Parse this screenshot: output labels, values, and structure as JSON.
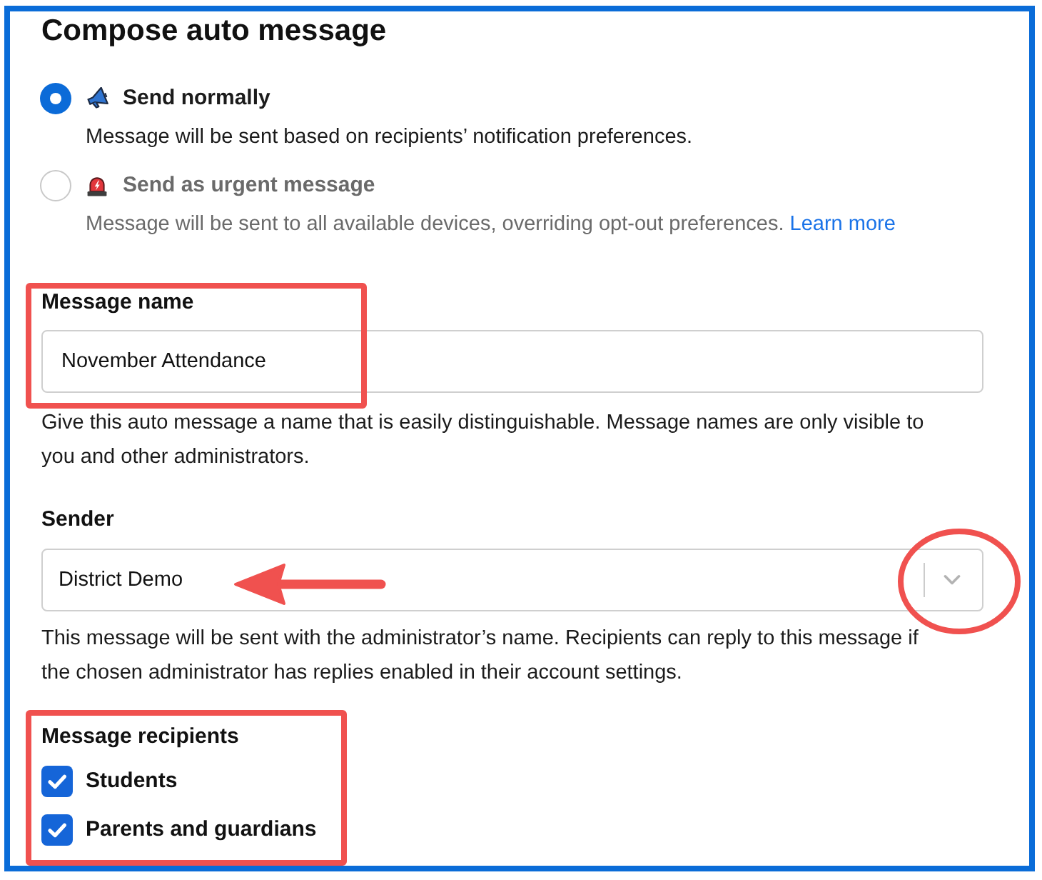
{
  "title": "Compose auto message",
  "delivery_options": [
    {
      "kind": "normal",
      "label": "Send normally",
      "description": "Message will be sent based on recipients’ notification preferences.",
      "selected": true
    },
    {
      "kind": "urgent",
      "label": "Send as urgent message",
      "description": "Message will be sent to all available devices, overriding opt-out preferences.",
      "link": "Learn more",
      "selected": false
    }
  ],
  "message_name": {
    "label": "Message name",
    "value": "November Attendance",
    "help": "Give this auto message a name that is easily distinguishable. Message names are only visible to you and other administrators."
  },
  "sender": {
    "label": "Sender",
    "value": "District Demo",
    "help": "This message will be sent with the administrator’s name. Recipients can reply to this message if the chosen administrator has replies enabled in their account settings."
  },
  "recipients": {
    "label": "Message recipients",
    "options": [
      {
        "label": "Students",
        "checked": true
      },
      {
        "label": "Parents and guardians",
        "checked": true
      }
    ]
  }
}
